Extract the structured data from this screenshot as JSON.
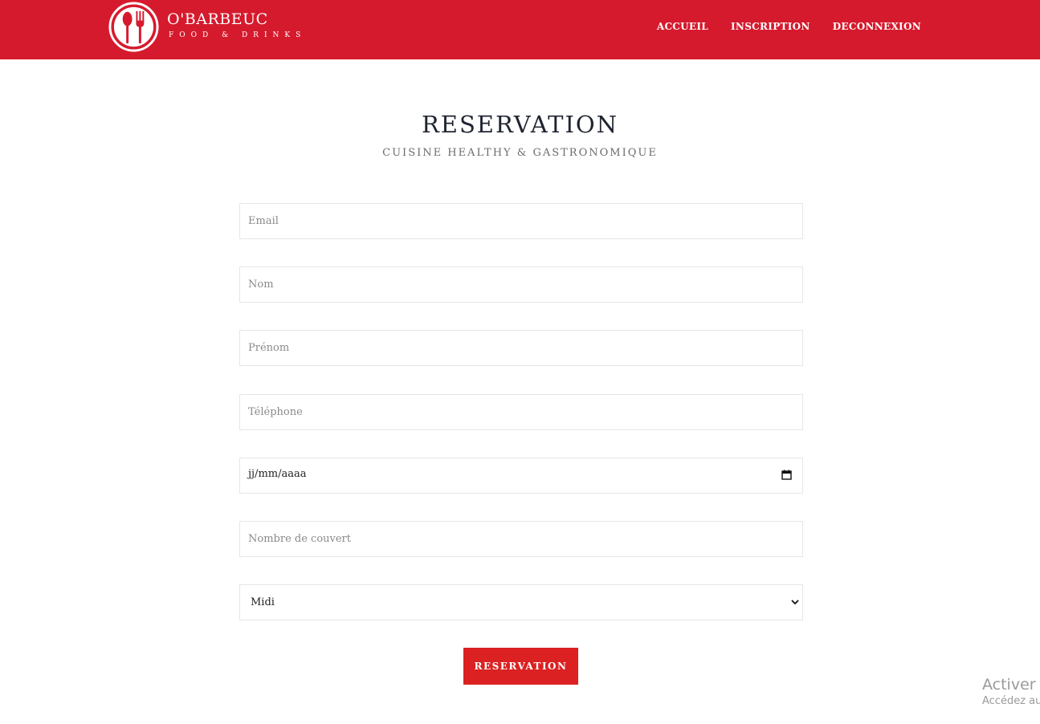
{
  "header": {
    "brand_name": "O'BARBEUC",
    "brand_tagline": "FOOD & DRINKS",
    "nav": [
      {
        "label": "ACCUEIL"
      },
      {
        "label": "INSCRIPTION"
      },
      {
        "label": "DECONNEXION"
      }
    ],
    "colors": {
      "background": "#d61a2d",
      "text": "#ffffff"
    }
  },
  "main": {
    "title": "RESERVATION",
    "subtitle": "CUISINE HEALTHY & GASTRONOMIQUE",
    "form": {
      "email": {
        "placeholder": "Email",
        "value": ""
      },
      "nom": {
        "placeholder": "Nom",
        "value": ""
      },
      "prenom": {
        "placeholder": "Prénom",
        "value": ""
      },
      "telephone": {
        "placeholder": "Téléphone",
        "value": ""
      },
      "date": {
        "display": "jj/mm/aaaa"
      },
      "couverts": {
        "placeholder": "Nombre de couvert",
        "value": ""
      },
      "service": {
        "selected": "Midi"
      },
      "submit_label": "RESERVATION"
    },
    "colors": {
      "button": "#db2121"
    }
  },
  "watermark": {
    "line1": "Activer W",
    "line2": "Accédez au"
  },
  "icons": [
    "spoon-fork-logo-icon",
    "calendar-icon",
    "chevron-down-icon"
  ]
}
